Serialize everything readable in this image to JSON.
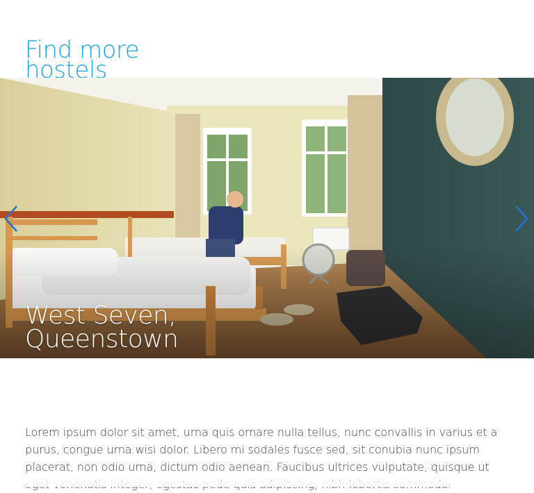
{
  "section": {
    "title": "Find more hostels"
  },
  "carousel": {
    "slide": {
      "name_line1": "West Seven,",
      "name_line2": "Queenstown",
      "image_icon": "hostel-dorm-room-photo"
    },
    "prev_icon": "chevron-left-icon",
    "next_icon": "chevron-right-icon",
    "arrow_color": "#1e73d8"
  },
  "description": {
    "text": "Lorem ipsum dolor sit amet, urna quis ornare nulla tellus, nunc convallis in varius et a purus, congue urna wisi dolor. Libero mi sodales fusce sed, sit conubia nunc ipsum placerat, non odio urna, dictum odio aenean. Faucibus ultrices vulputate, quisque ut eget venenatis integer, egestas pede quis adipiscing, nibh lobortis commodo."
  },
  "colors": {
    "accent": "#1ea3e6",
    "body_text": "#3f3f3f"
  }
}
